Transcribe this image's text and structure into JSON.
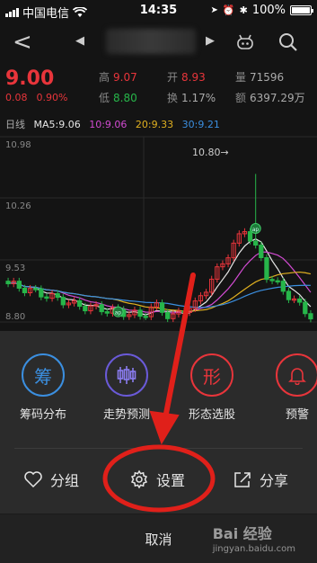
{
  "status_bar": {
    "carrier": "中国电信",
    "time": "14:35",
    "battery": "100%",
    "battery_level": 1.0
  },
  "quote": {
    "price": "9.00",
    "change": "0.08",
    "change_pct": "0.90%",
    "high_label": "高",
    "high": "9.07",
    "low_label": "低",
    "low": "8.80",
    "open_label": "开",
    "open": "8.93",
    "turnover_label": "换",
    "turnover": "1.17%",
    "volume_label": "量",
    "volume": "71596",
    "amount_label": "额",
    "amount": "6397.29万"
  },
  "ma_bar": {
    "period": "日线",
    "ma5": "MA5:9.06",
    "ma10": "10:9.06",
    "ma20": "20:9.33",
    "ma30": "30:9.21"
  },
  "chart_data": {
    "type": "candlestick",
    "y_ticks": [
      "10.98",
      "10.26",
      "9.53",
      "8.80"
    ],
    "ylim": [
      8.8,
      10.98
    ],
    "annotation": "10.80→",
    "markers": [
      "ap",
      "ap"
    ]
  },
  "sheet": {
    "options": [
      {
        "icon": "筹",
        "label": "筹码分布"
      },
      {
        "icon": "candles",
        "label": "走势预测"
      },
      {
        "icon": "形",
        "label": "形态选股"
      },
      {
        "icon": "bell",
        "label": "预警"
      }
    ],
    "actions": {
      "group": "分组",
      "settings": "设置",
      "share": "分享"
    },
    "cancel": "取消"
  },
  "watermark": {
    "brand": "Bai 经验",
    "url": "jingyan.baidu.com"
  },
  "colors": {
    "up": "#e8353b",
    "down": "#27b64a",
    "ma5": "#e6e6e6",
    "ma10": "#d24bd2",
    "ma20": "#e0b020",
    "ma30": "#3b8fe0",
    "annotation": "#e0201a"
  }
}
